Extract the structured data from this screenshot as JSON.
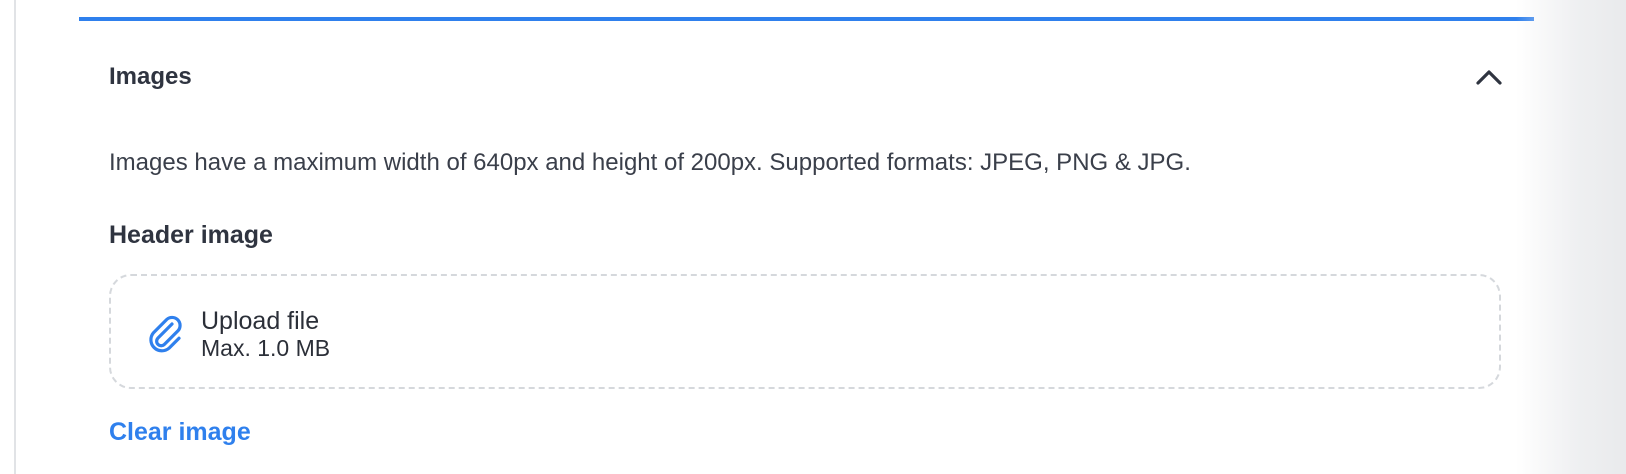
{
  "panel": {
    "title": "Images",
    "accent_color": "#2f80ed",
    "collapse_icon": "chevron-up-icon",
    "expanded": true
  },
  "description": "Images have a maximum width of 640px and height of 200px. Supported formats: JPEG, PNG & JPG.",
  "header_image": {
    "label": "Header image",
    "upload": {
      "icon": "paperclip-icon",
      "title": "Upload file",
      "limit": "Max. 1.0 MB"
    },
    "clear_label": "Clear image"
  }
}
